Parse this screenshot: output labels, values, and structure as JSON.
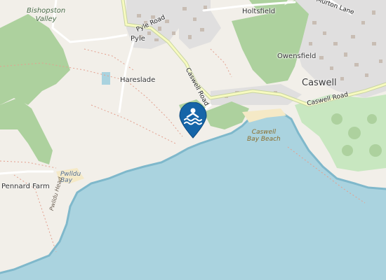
{
  "labels": {
    "bishopston_valley_line1": "Bishopston",
    "bishopston_valley_line2": "Valley",
    "pyle_road": "Pyle Road",
    "pyle": "Pyle",
    "holtsfield": "Holtsfield",
    "murton_lane": "Murton Lane",
    "owensfield": "Owensfield",
    "caswell": "Caswell",
    "caswell_road_vertical": "Caswell Road",
    "caswell_road_east": "Caswell Road",
    "hareslade": "Hareslade",
    "caswell_bay_beach_line1": "Caswell",
    "caswell_bay_beach_line2": "Bay Beach",
    "pwlldu_bay_line1": "Pwlldu",
    "pwlldu_bay_line2": "Bay",
    "pennard_farm": "Pennard Farm",
    "cliff_label": "Pwlldu Head"
  },
  "marker": {
    "icon": "swimming-icon",
    "color": "#1565a8",
    "symbol_color": "#ffffff"
  },
  "colors": {
    "land": "#f2efe9",
    "sea": "#aad3df",
    "woodland": "#add19e",
    "golf": "#c8e7c0",
    "residential": "#e0dfdf",
    "building": "#c8bdb3",
    "sand": "#f5e9c6",
    "coast_cliff": "#7fb8cb"
  }
}
